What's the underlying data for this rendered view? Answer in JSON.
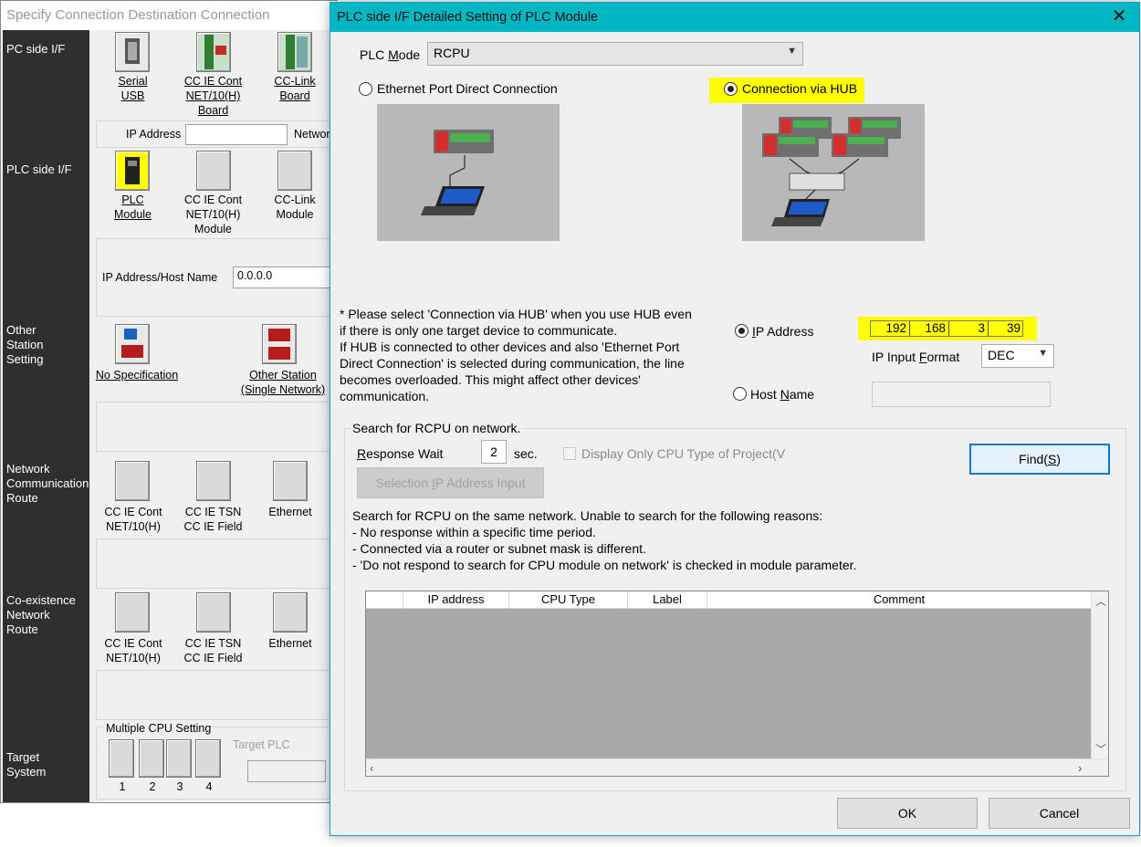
{
  "background_window": {
    "title": "Specify Connection Destination Connection",
    "sidebar": {
      "pc_side": "PC side I/F",
      "plc_side": "PLC side I/F",
      "other_station": "Other\nStation\nSetting",
      "network_route": "Network\nCommunication\nRoute",
      "coexistence": "Co-existence\nNetwork\nRoute",
      "target_system": "Target\nSystem"
    },
    "pc_items": [
      "Serial\nUSB",
      "CC IE Cont\nNET/10(H)\nBoard",
      "CC-Link\nBoard"
    ],
    "ip_address_label": "IP Address",
    "network_label_partial": "Networ",
    "plc_items": [
      "PLC\nModule",
      "CC IE Cont\nNET/10(H)\nModule",
      "CC-Link\nModule"
    ],
    "ip_host_label": "IP Address/Host Name",
    "ip_host_value": "0.0.0.0",
    "other_items": [
      "No Specification",
      "Other Station\n(Single Network)"
    ],
    "route_items": [
      "CC IE Cont\nNET/10(H)",
      "CC IE TSN\nCC IE Field",
      "Ethernet"
    ],
    "coexist_items": [
      "CC IE Cont\nNET/10(H)",
      "CC IE TSN\nCC IE Field",
      "Ethernet"
    ],
    "multiple_cpu_label": "Multiple CPU Setting",
    "target_plc_label": "Target PLC",
    "cpu_numbers": [
      "1",
      "2",
      "3",
      "4"
    ]
  },
  "dialog": {
    "title": "PLC side I/F Detailed Setting of PLC Module",
    "plc_mode_label": "PLC Mode",
    "plc_mode_value": "RCPU",
    "direct_connection_label": "Ethernet Port Direct Connection",
    "hub_connection_label": "Connection via HUB",
    "note": "* Please select 'Connection via HUB' when you use HUB even\nif there is only one target device to communicate.\nIf HUB is connected to other devices and also 'Ethernet Port\nDirect Connection' is selected during communication, the line\nbecomes overloaded. This might affect other devices'\ncommunication.",
    "ip_address_label": "IP Address",
    "ip_octets": [
      "192",
      "168",
      "3",
      "39"
    ],
    "ip_input_format_label": "IP Input Format",
    "ip_input_format_value": "DEC",
    "host_name_label": "Host Name",
    "search_group_label": "Search for RCPU on network.",
    "response_wait_label": "Response Wait",
    "response_wait_value": "2",
    "response_wait_unit": "sec.",
    "display_only_label": "Display Only CPU Type of Project(V",
    "find_button": "Find(S)",
    "selection_ip_button": "Selection IP Address Input",
    "search_info": "Search for RCPU on the same network. Unable to search for the following reasons:\n- No response within a specific time period.\n- Connected via a router or subnet mask is different.\n- 'Do not respond to search for CPU module on network' is checked in module parameter.",
    "grid_columns": [
      "",
      "IP address",
      "CPU Type",
      "Label",
      "Comment"
    ],
    "ok_button": "OK",
    "cancel_button": "Cancel"
  },
  "colors": {
    "title_bar": "#00b7c3",
    "highlight": "#ffff00",
    "sidebar": "#2f2f2f"
  }
}
